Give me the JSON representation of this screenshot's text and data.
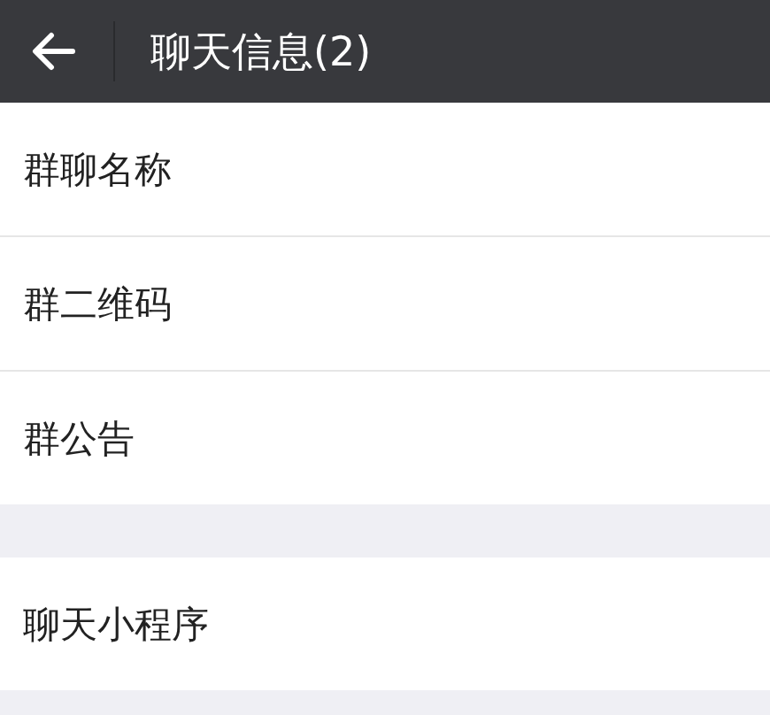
{
  "header": {
    "title": "聊天信息(2)"
  },
  "sections": [
    {
      "items": [
        {
          "label": "群聊名称"
        },
        {
          "label": "群二维码"
        },
        {
          "label": "群公告"
        }
      ]
    },
    {
      "items": [
        {
          "label": "聊天小程序"
        }
      ]
    }
  ]
}
